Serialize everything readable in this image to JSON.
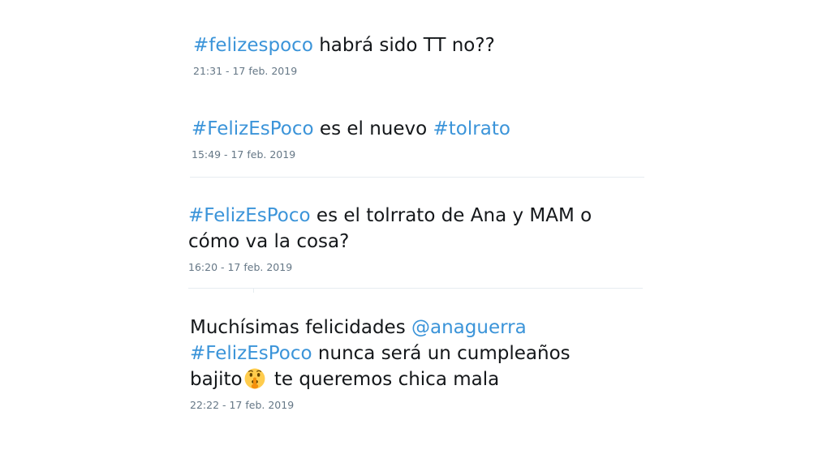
{
  "tweets": [
    {
      "hashtag": "#felizespoco",
      "text": " habrá sido TT no??",
      "time": "21:31 - 17 feb. 2019"
    },
    {
      "hashtag": "#FelizEsPoco",
      "text_middle": " es el nuevo ",
      "hashtag2": "#tolrato",
      "time": "15:49 - 17 feb. 2019"
    },
    {
      "hashtag": "#FelizEsPoco",
      "text_line1": " es el tolrrato de Ana y MAM o",
      "text_line2": "cómo va la cosa?",
      "time": "16:20 - 17 feb. 2019"
    },
    {
      "text_start": "Muchísimas felicidades ",
      "mention": "@anaguerra",
      "hashtag": "#FelizEsPoco",
      "text_line2": " nunca será un cumpleaños",
      "text_line3_start": "bajito",
      "emoji": "shushing-face-emoji",
      "text_line3_end": "te queremos chica mala",
      "time": "22:22 - 17 feb. 2019"
    }
  ],
  "colors": {
    "link": "#3b94d9",
    "text": "#14171a",
    "meta": "#657786",
    "divider": "#e6ecf0"
  }
}
